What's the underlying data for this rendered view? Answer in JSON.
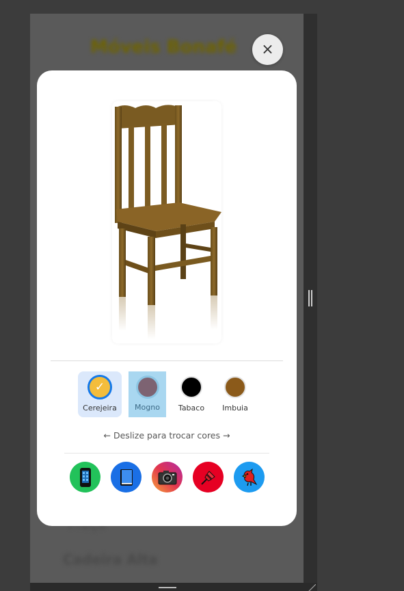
{
  "background": {
    "title": "Móveis Bonafé",
    "line1": "Preço",
    "line2": "Cadeira Alta"
  },
  "modal": {
    "close_label": "×",
    "product_image": "wooden-chair",
    "swatches": [
      {
        "label": "Cerejeira",
        "color": "#f4bd3c",
        "selected": true
      },
      {
        "label": "Mogno",
        "color": "#7d6372",
        "selected": false
      },
      {
        "label": "Tabaco",
        "color": "#000000",
        "selected": false
      },
      {
        "label": "Imbuia",
        "color": "#8b5a1a",
        "selected": false
      }
    ],
    "swatch_check": "✓",
    "hint": "← Deslize para trocar cores →",
    "share_buttons": [
      {
        "name": "whatsapp",
        "icon": "mobile-phone-icon",
        "color": "#22c25a"
      },
      {
        "name": "facebook",
        "icon": "blue-book-icon",
        "color": "#1a6fe5"
      },
      {
        "name": "instagram",
        "icon": "camera-icon",
        "color": "#e2364f"
      },
      {
        "name": "pinterest",
        "icon": "pushpin-icon",
        "color": "#e60023"
      },
      {
        "name": "twitter",
        "icon": "red-bird-icon",
        "color": "#1d9bf0"
      }
    ]
  }
}
